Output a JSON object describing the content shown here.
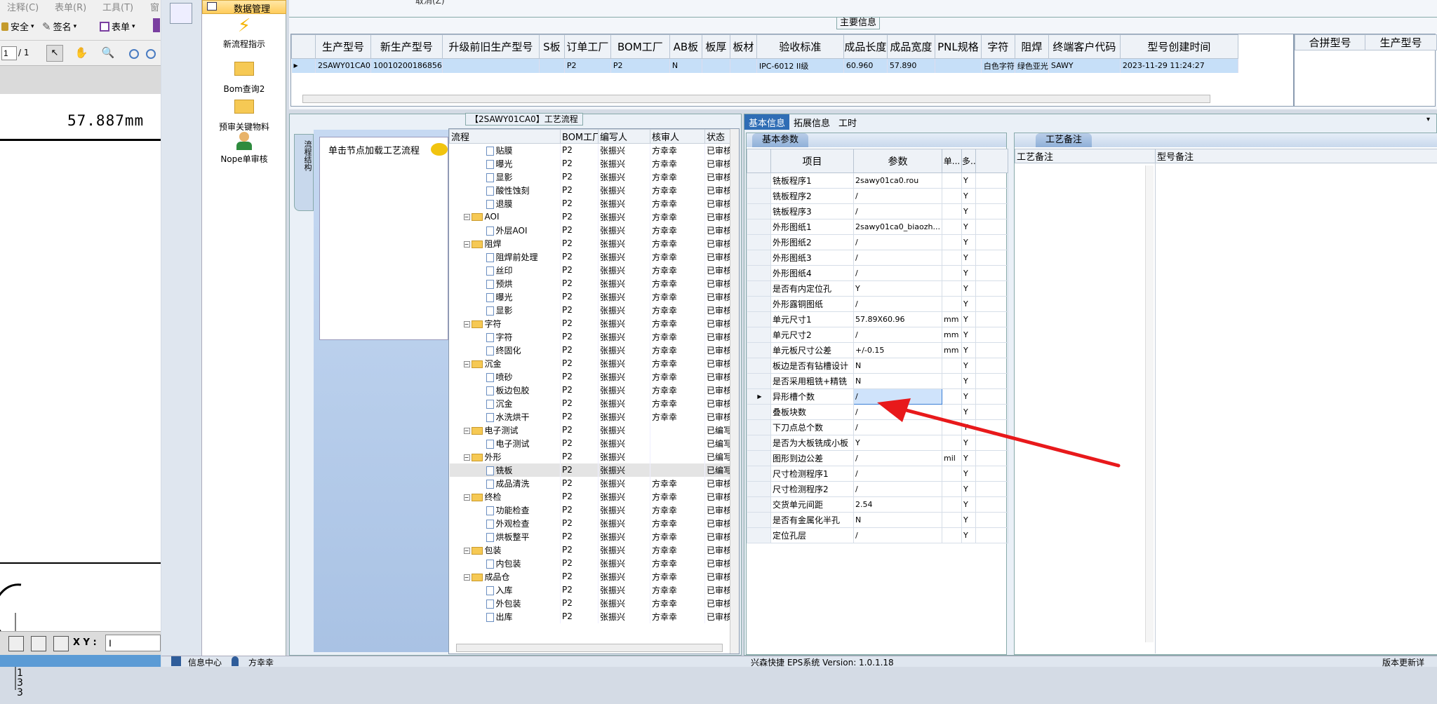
{
  "pdf": {
    "menu": [
      "注释(C)",
      "表单(R)",
      "工具(T)",
      "窗"
    ],
    "toolbar": {
      "security": "安全",
      "sign": "签名",
      "form": "表单"
    },
    "page_input": "1",
    "page_total": "/ 1",
    "dimension_text": "57.887mm",
    "bottom_label": "X Y :",
    "bottom_input": "I"
  },
  "nav": {
    "header": "数据管理",
    "items": [
      "新流程指示",
      "Bom查询2",
      "预审关键物料",
      "Nope单审核"
    ]
  },
  "top": {
    "cut_text": "取消(Z)",
    "main_legend": "主要信息",
    "columns": [
      "生产型号",
      "新生产型号",
      "升级前旧生产型号",
      "S板",
      "订单工厂",
      "BOM工厂",
      "AB板",
      "板厚",
      "板材",
      "验收标准",
      "成品长度",
      "成品宽度",
      "PNL规格",
      "字符",
      "阻焊",
      "终端客户代码",
      "型号创建时间"
    ],
    "row": [
      "2SAWY01CA0",
      "10010200186856",
      "",
      "",
      "P2",
      "P2",
      "N",
      "",
      "",
      "IPC-6012 II级",
      "60.960",
      "57.890",
      "",
      "白色字符",
      "绿色亚光",
      "SAWY",
      "2023-11-29 11:24:27"
    ],
    "side_columns": [
      "合拼型号",
      "生产型号"
    ]
  },
  "flow": {
    "title": "【2SAWY01CA0】工艺流程",
    "left_tab": "流程结构",
    "hint": "单击节点加载工艺流程",
    "columns": [
      "流程",
      "BOM工厂",
      "编写人",
      "核审人",
      "状态"
    ],
    "rows": [
      {
        "t": "doc",
        "name": "贴膜",
        "bom": "P2",
        "w": "张振兴",
        "r": "方幸幸",
        "s": "已审核"
      },
      {
        "t": "doc",
        "name": "曝光",
        "bom": "P2",
        "w": "张振兴",
        "r": "方幸幸",
        "s": "已审核"
      },
      {
        "t": "doc",
        "name": "显影",
        "bom": "P2",
        "w": "张振兴",
        "r": "方幸幸",
        "s": "已审核"
      },
      {
        "t": "doc",
        "name": "酸性蚀刻",
        "bom": "P2",
        "w": "张振兴",
        "r": "方幸幸",
        "s": "已审核"
      },
      {
        "t": "doc",
        "name": "退膜",
        "bom": "P2",
        "w": "张振兴",
        "r": "方幸幸",
        "s": "已审核"
      },
      {
        "t": "fold",
        "name": "AOI",
        "bom": "P2",
        "w": "张振兴",
        "r": "方幸幸",
        "s": "已审核"
      },
      {
        "t": "doc",
        "name": "外层AOI",
        "bom": "P2",
        "w": "张振兴",
        "r": "方幸幸",
        "s": "已审核"
      },
      {
        "t": "fold",
        "name": "阻焊",
        "bom": "P2",
        "w": "张振兴",
        "r": "方幸幸",
        "s": "已审核"
      },
      {
        "t": "doc",
        "name": "阻焊前处理",
        "bom": "P2",
        "w": "张振兴",
        "r": "方幸幸",
        "s": "已审核"
      },
      {
        "t": "doc",
        "name": "丝印",
        "bom": "P2",
        "w": "张振兴",
        "r": "方幸幸",
        "s": "已审核"
      },
      {
        "t": "doc",
        "name": "预烘",
        "bom": "P2",
        "w": "张振兴",
        "r": "方幸幸",
        "s": "已审核"
      },
      {
        "t": "doc",
        "name": "曝光",
        "bom": "P2",
        "w": "张振兴",
        "r": "方幸幸",
        "s": "已审核"
      },
      {
        "t": "doc",
        "name": "显影",
        "bom": "P2",
        "w": "张振兴",
        "r": "方幸幸",
        "s": "已审核"
      },
      {
        "t": "fold",
        "name": "字符",
        "bom": "P2",
        "w": "张振兴",
        "r": "方幸幸",
        "s": "已审核"
      },
      {
        "t": "doc",
        "name": "字符",
        "bom": "P2",
        "w": "张振兴",
        "r": "方幸幸",
        "s": "已审核"
      },
      {
        "t": "doc",
        "name": "终固化",
        "bom": "P2",
        "w": "张振兴",
        "r": "方幸幸",
        "s": "已审核"
      },
      {
        "t": "fold",
        "name": "沉金",
        "bom": "P2",
        "w": "张振兴",
        "r": "方幸幸",
        "s": "已审核"
      },
      {
        "t": "doc",
        "name": "喷砂",
        "bom": "P2",
        "w": "张振兴",
        "r": "方幸幸",
        "s": "已审核"
      },
      {
        "t": "doc",
        "name": "板边包胶",
        "bom": "P2",
        "w": "张振兴",
        "r": "方幸幸",
        "s": "已审核"
      },
      {
        "t": "doc",
        "name": "沉金",
        "bom": "P2",
        "w": "张振兴",
        "r": "方幸幸",
        "s": "已审核"
      },
      {
        "t": "doc",
        "name": "水洗烘干",
        "bom": "P2",
        "w": "张振兴",
        "r": "方幸幸",
        "s": "已审核"
      },
      {
        "t": "fold",
        "name": "电子测试",
        "bom": "P2",
        "w": "张振兴",
        "r": "",
        "s": "已编写"
      },
      {
        "t": "doc",
        "name": "电子测试",
        "bom": "P2",
        "w": "张振兴",
        "r": "",
        "s": "已编写"
      },
      {
        "t": "fold",
        "name": "外形",
        "bom": "P2",
        "w": "张振兴",
        "r": "",
        "s": "已编写"
      },
      {
        "t": "doc",
        "name": "铣板",
        "bom": "P2",
        "w": "张振兴",
        "r": "",
        "s": "已编写",
        "sel": true
      },
      {
        "t": "doc",
        "name": "成品清洗",
        "bom": "P2",
        "w": "张振兴",
        "r": "方幸幸",
        "s": "已审核"
      },
      {
        "t": "fold",
        "name": "终检",
        "bom": "P2",
        "w": "张振兴",
        "r": "方幸幸",
        "s": "已审核"
      },
      {
        "t": "doc",
        "name": "功能检查",
        "bom": "P2",
        "w": "张振兴",
        "r": "方幸幸",
        "s": "已审核"
      },
      {
        "t": "doc",
        "name": "外观检查",
        "bom": "P2",
        "w": "张振兴",
        "r": "方幸幸",
        "s": "已审核"
      },
      {
        "t": "doc",
        "name": "烘板整平",
        "bom": "P2",
        "w": "张振兴",
        "r": "方幸幸",
        "s": "已审核"
      },
      {
        "t": "fold",
        "name": "包装",
        "bom": "P2",
        "w": "张振兴",
        "r": "方幸幸",
        "s": "已审核"
      },
      {
        "t": "doc",
        "name": "内包装",
        "bom": "P2",
        "w": "张振兴",
        "r": "方幸幸",
        "s": "已审核"
      },
      {
        "t": "fold",
        "name": "成品仓",
        "bom": "P2",
        "w": "张振兴",
        "r": "方幸幸",
        "s": "已审核"
      },
      {
        "t": "doc",
        "name": "入库",
        "bom": "P2",
        "w": "张振兴",
        "r": "方幸幸",
        "s": "已审核"
      },
      {
        "t": "doc",
        "name": "外包装",
        "bom": "P2",
        "w": "张振兴",
        "r": "方幸幸",
        "s": "已审核"
      },
      {
        "t": "doc",
        "name": "出库",
        "bom": "P2",
        "w": "张振兴",
        "r": "方幸幸",
        "s": "已审核"
      }
    ]
  },
  "info": {
    "tabs": [
      "基本信息",
      "拓展信息",
      "工时"
    ],
    "basic_title": "基本参数",
    "param_columns": [
      "项目",
      "参数",
      "单...",
      "多..."
    ],
    "params": [
      {
        "k": "铣板程序1",
        "v": "2sawy01ca0.rou",
        "u": "",
        "m": "Y"
      },
      {
        "k": "铣板程序2",
        "v": "/",
        "u": "",
        "m": "Y"
      },
      {
        "k": "铣板程序3",
        "v": "/",
        "u": "",
        "m": "Y"
      },
      {
        "k": "外形图纸1",
        "v": "2sawy01ca0_biaozh...",
        "u": "",
        "m": "Y"
      },
      {
        "k": "外形图纸2",
        "v": "/",
        "u": "",
        "m": "Y"
      },
      {
        "k": "外形图纸3",
        "v": "/",
        "u": "",
        "m": "Y"
      },
      {
        "k": "外形图纸4",
        "v": "/",
        "u": "",
        "m": "Y"
      },
      {
        "k": "是否有内定位孔",
        "v": "Y",
        "u": "",
        "m": "Y"
      },
      {
        "k": "外形露铜图纸",
        "v": "/",
        "u": "",
        "m": "Y"
      },
      {
        "k": "单元尺寸1",
        "v": "57.89X60.96",
        "u": "mm",
        "m": "Y"
      },
      {
        "k": "单元尺寸2",
        "v": "/",
        "u": "mm",
        "m": "Y"
      },
      {
        "k": "单元板尺寸公差",
        "v": "+/-0.15",
        "u": "mm",
        "m": "Y"
      },
      {
        "k": "板边是否有钻槽设计",
        "v": "N",
        "u": "",
        "m": "Y"
      },
      {
        "k": "是否采用粗铣+精铣",
        "v": "N",
        "u": "",
        "m": "Y"
      },
      {
        "k": "异形槽个数",
        "v": "/",
        "u": "",
        "m": "Y",
        "sel": true
      },
      {
        "k": "叠板块数",
        "v": "/",
        "u": "",
        "m": "Y"
      },
      {
        "k": "下刀点总个数",
        "v": "/",
        "u": "",
        "m": "Y"
      },
      {
        "k": "是否为大板铣成小板",
        "v": "Y",
        "u": "",
        "m": "Y"
      },
      {
        "k": "图形到边公差",
        "v": "/",
        "u": "mil",
        "m": "Y"
      },
      {
        "k": "尺寸检测程序1",
        "v": "/",
        "u": "",
        "m": "Y"
      },
      {
        "k": "尺寸检测程序2",
        "v": "/",
        "u": "",
        "m": "Y"
      },
      {
        "k": "交货单元间距",
        "v": "2.54",
        "u": "",
        "m": "Y"
      },
      {
        "k": "是否有金属化半孔",
        "v": "N",
        "u": "",
        "m": "Y"
      },
      {
        "k": "定位孔层",
        "v": "/",
        "u": "",
        "m": "Y"
      }
    ],
    "proc_title": "工艺备注",
    "proc_columns": [
      "工艺备注",
      "型号备注"
    ]
  },
  "status": {
    "left": "信息中心",
    "user": "方幸幸",
    "center": "兴森快捷 EPS系统 Version: 1.0.1.18",
    "right": "版本更新详"
  },
  "colors": {
    "accent": "#2f6db5",
    "arrow": "#e8191b",
    "selection": "#c6dff8"
  }
}
